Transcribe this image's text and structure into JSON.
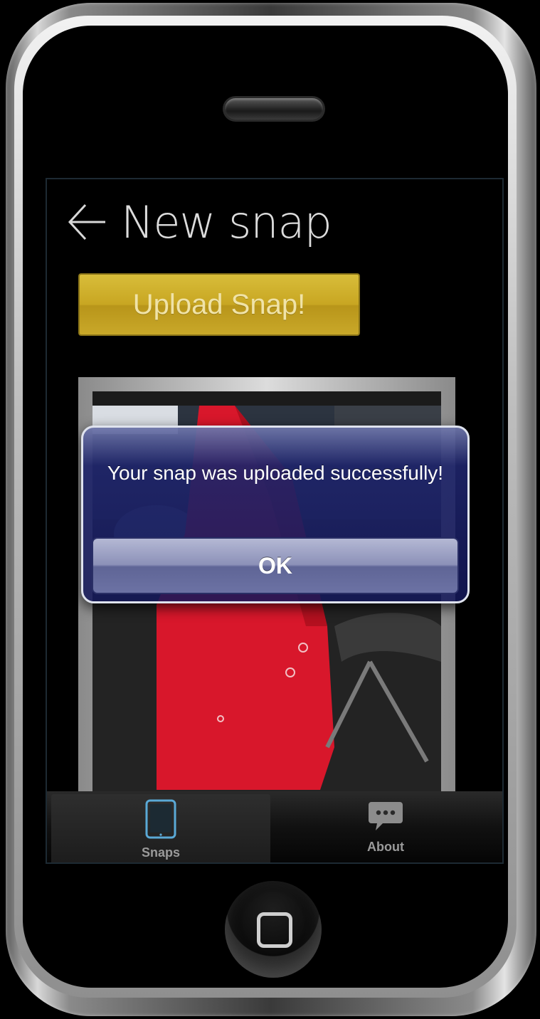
{
  "header": {
    "title": "New snap",
    "back_icon": "back-arrow-icon"
  },
  "upload_button": {
    "label": "Upload Snap!",
    "color": "#c8a622"
  },
  "alert": {
    "message": "Your snap was uploaded successfully!",
    "ok_label": "OK"
  },
  "tabbar": {
    "tabs": [
      {
        "label": "Snaps",
        "icon": "tablet-icon",
        "active": true
      },
      {
        "label": "About",
        "icon": "chat-bubble-icon",
        "active": false
      }
    ]
  },
  "colors": {
    "accent_gold": "#c8a622",
    "alert_blue": "#1e2469",
    "tab_icon_active": "#5aa9d6"
  }
}
